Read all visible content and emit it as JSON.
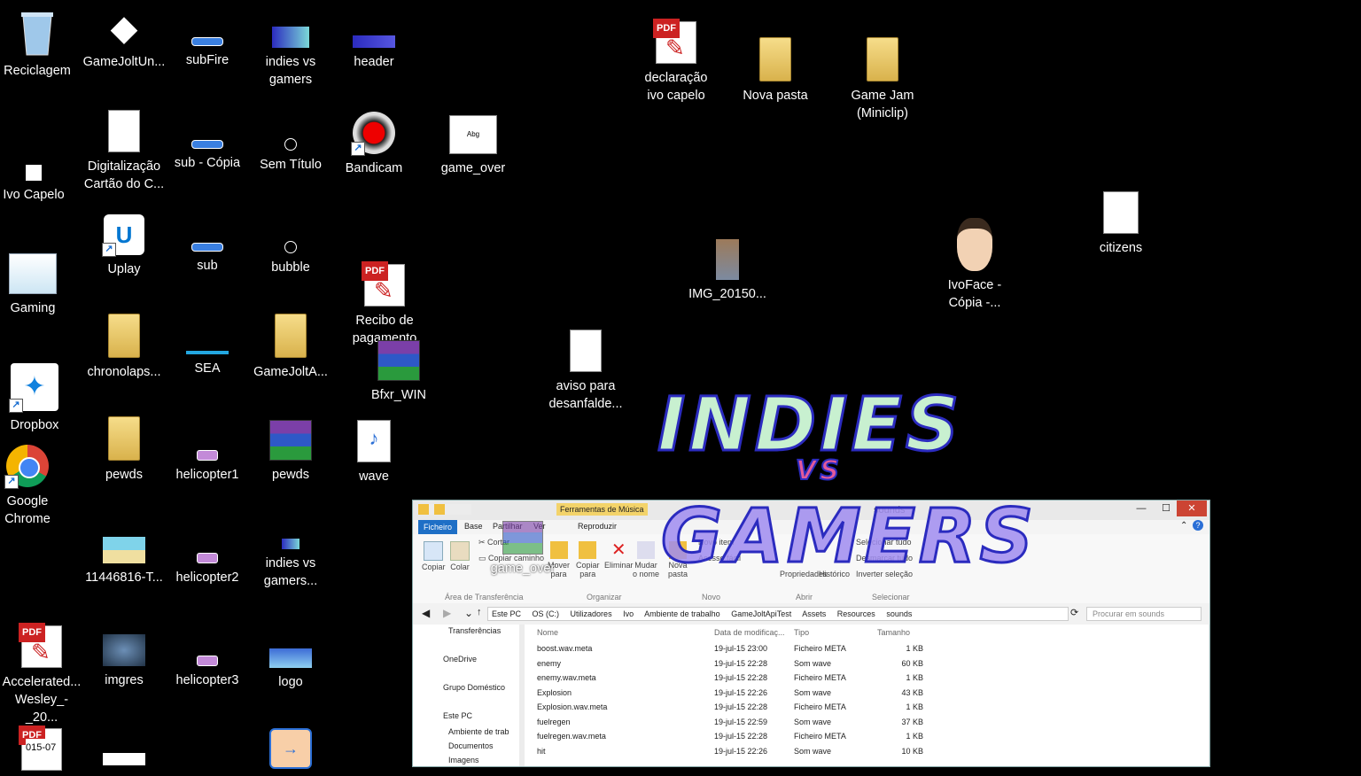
{
  "desktop": {
    "icons": [
      {
        "label": "Reciclagem"
      },
      {
        "label": "GameJoltUn..."
      },
      {
        "label": "subFire"
      },
      {
        "label": "indies vs\ngamers"
      },
      {
        "label": "header"
      },
      {
        "label": "Digitalização\nCartão do C..."
      },
      {
        "label": "sub - Cópia"
      },
      {
        "label": "Sem Título"
      },
      {
        "label": "Bandicam"
      },
      {
        "label": "game_over"
      },
      {
        "label": "Ivo Capelo"
      },
      {
        "label": "Uplay"
      },
      {
        "label": "sub"
      },
      {
        "label": "bubble"
      },
      {
        "label": "Recibo de\npagamento"
      },
      {
        "label": "Gaming"
      },
      {
        "label": "chronolaps..."
      },
      {
        "label": "SEA"
      },
      {
        "label": "GameJoltA..."
      },
      {
        "label": "Bfxr_WIN"
      },
      {
        "label": "Dropbox"
      },
      {
        "label": "pewds"
      },
      {
        "label": "helicopter1"
      },
      {
        "label": "pewds"
      },
      {
        "label": "wave"
      },
      {
        "label": "Google\nChrome"
      },
      {
        "label": "11446816-T..."
      },
      {
        "label": "helicopter2"
      },
      {
        "label": "indies vs\ngamers..."
      },
      {
        "label": "Accelerated...\nWesley_-_20..."
      },
      {
        "label": "imgres"
      },
      {
        "label": "helicopter3"
      },
      {
        "label": "logo"
      },
      {
        "label": "declaração\nivo capelo"
      },
      {
        "label": "Nova pasta"
      },
      {
        "label": "Game Jam\n(Miniclip)"
      },
      {
        "label": "IMG_20150..."
      },
      {
        "label": "IvoFace -\nCópia -..."
      },
      {
        "label": "citizens"
      },
      {
        "label": "aviso para\ndesanfalde..."
      },
      {
        "label": "game_over"
      }
    ],
    "partial_text": "015-07",
    "wallpaper_logo": {
      "line1": "INDIES",
      "line2": "VS",
      "line3": "GAMERS"
    }
  },
  "explorer": {
    "context_tab": "Ferramentas de Música",
    "title": "sounds",
    "tabs": [
      "Ficheiro",
      "Base",
      "Partilhar",
      "Ver",
      "Reproduzir"
    ],
    "ribbon": {
      "buttons": [
        "Copiar",
        "Colar",
        "Cortar",
        "Copiar caminho",
        "Mover\npara",
        "Copiar\npara",
        "Eliminar",
        "Mudar\no nome",
        "Nova\npasta",
        "Novo item",
        "Acesso fácil",
        "Propriedades",
        "Histórico",
        "Selecionar tudo",
        "Desmarcar tudo",
        "Inverter seleção"
      ],
      "groups": [
        "Área de Transferência",
        "Organizar",
        "Novo",
        "Abrir",
        "Selecionar"
      ]
    },
    "breadcrumb": [
      "Este PC",
      "OS (C:)",
      "Utilizadores",
      "Ivo",
      "Ambiente de trabalho",
      "GameJoltApiTest",
      "Assets",
      "Resources",
      "sounds"
    ],
    "search_placeholder": "Procurar em sounds",
    "nav": [
      "Transferências",
      "OneDrive",
      "Grupo Doméstico",
      "Este PC",
      "Ambiente de trab",
      "Documentos",
      "Imagens"
    ],
    "columns": [
      "Nome",
      "Data de modificaç...",
      "Tipo",
      "Tamanho"
    ],
    "files": [
      {
        "name": "boost.wav.meta",
        "date": "19-jul-15 23:00",
        "type": "Ficheiro META",
        "size": "1 KB"
      },
      {
        "name": "enemy",
        "date": "19-jul-15 22:28",
        "type": "Som wave",
        "size": "60 KB"
      },
      {
        "name": "enemy.wav.meta",
        "date": "19-jul-15 22:28",
        "type": "Ficheiro META",
        "size": "1 KB"
      },
      {
        "name": "Explosion",
        "date": "19-jul-15 22:26",
        "type": "Som wave",
        "size": "43 KB"
      },
      {
        "name": "Explosion.wav.meta",
        "date": "19-jul-15 22:28",
        "type": "Ficheiro META",
        "size": "1 KB"
      },
      {
        "name": "fuelregen",
        "date": "19-jul-15 22:59",
        "type": "Som wave",
        "size": "37 KB"
      },
      {
        "name": "fuelregen.wav.meta",
        "date": "19-jul-15 22:28",
        "type": "Ficheiro META",
        "size": "1 KB"
      },
      {
        "name": "hit",
        "date": "19-jul-15 22:26",
        "type": "Som wave",
        "size": "10 KB"
      }
    ]
  }
}
